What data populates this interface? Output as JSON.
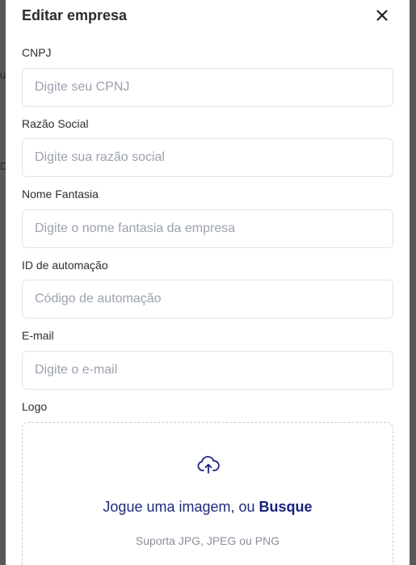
{
  "background": {
    "fragments": [
      "u",
      "D"
    ]
  },
  "modal": {
    "title": "Editar empresa",
    "close_icon": "close-icon"
  },
  "fields": {
    "cnpj": {
      "label": "CNPJ",
      "placeholder": "Digite seu CPNJ",
      "value": ""
    },
    "razao_social": {
      "label": "Razão Social",
      "placeholder": "Digite sua razão social",
      "value": ""
    },
    "nome_fantasia": {
      "label": "Nome Fantasia",
      "placeholder": "Digite o nome fantasia da empresa",
      "value": ""
    },
    "id_automacao": {
      "label": "ID de automação",
      "placeholder": "Código de automação",
      "value": ""
    },
    "email": {
      "label": "E-mail",
      "placeholder": "Digite o e-mail",
      "value": ""
    }
  },
  "logo": {
    "label": "Logo",
    "drop_text": "Jogue uma imagem, ou",
    "browse_link": "Busque",
    "hint": "Suporta JPG, JPEG ou PNG",
    "icon": "cloud-upload-icon"
  },
  "colors": {
    "accent": "#1a237e",
    "border": "#e2e4e9",
    "placeholder": "#9ba1ad"
  }
}
